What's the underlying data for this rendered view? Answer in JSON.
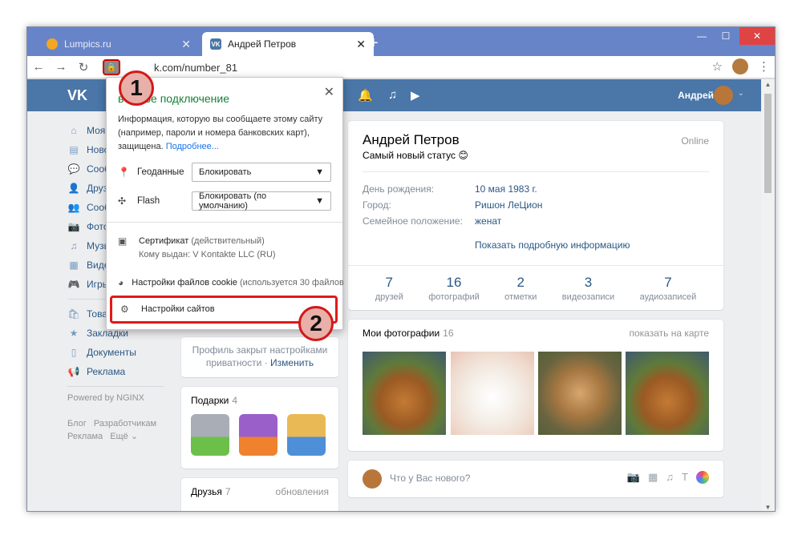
{
  "browser": {
    "tabs": [
      {
        "title": "Lumpics.ru",
        "active": false
      },
      {
        "title": "Андрей Петров",
        "active": true
      }
    ],
    "url": "vk.com/number_81",
    "url_visible": "k.com/number_81",
    "icons": [
      "back-icon",
      "forward-icon",
      "reload-icon",
      "lock-icon",
      "star-icon",
      "menu-icon"
    ]
  },
  "header": {
    "logo": "VK",
    "user_name": "Андрей"
  },
  "leftnav": {
    "items": [
      {
        "label": "Моя",
        "icon": "home-icon"
      },
      {
        "label": "Ново",
        "icon": "news-icon"
      },
      {
        "label": "Сооб",
        "icon": "messages-icon"
      },
      {
        "label": "Друз",
        "icon": "friends-icon"
      },
      {
        "label": "Сооб",
        "icon": "groups-icon"
      },
      {
        "label": "Фото",
        "icon": "photo-icon"
      },
      {
        "label": "Музы",
        "icon": "music-icon"
      },
      {
        "label": "Виде",
        "icon": "video-icon"
      },
      {
        "label": "Игры",
        "icon": "games-icon"
      }
    ],
    "items2": [
      {
        "label": "Това",
        "icon": "goods-icon"
      },
      {
        "label": "Закладки",
        "icon": "bookmarks-icon"
      },
      {
        "label": "Документы",
        "icon": "documents-icon"
      },
      {
        "label": "Реклама",
        "icon": "ads-icon"
      }
    ],
    "powered": "Powered by NGINX",
    "footer1": "Блог   Разработчикам",
    "footer2": "Реклама   Ещё ⌄"
  },
  "popup": {
    "title": "Безопасное подключение",
    "title_visible": "в   зное подключение",
    "description": "Информация, которую вы сообщаете этому сайту (например, пароли и номера банковских карт), защищена.",
    "more_link": "Подробнее...",
    "permissions": [
      {
        "label": "Геоданные",
        "value": "Блокировать",
        "icon": "location-icon"
      },
      {
        "label": "Flash",
        "value": "Блокировать (по умолчанию)",
        "icon": "puzzle-icon"
      }
    ],
    "certificate": {
      "label": "Сертификат",
      "state": "(действительный)",
      "issued": "Кому выдан: V Kontakte LLC (RU)"
    },
    "cookies": {
      "label": "Настройки файлов cookie",
      "note": "(используется 30 файлов"
    },
    "site_settings": "Настройки сайтов"
  },
  "profile": {
    "name": "Андрей Петров",
    "online": "Online",
    "status": "Самый новый статус 😊",
    "info": [
      {
        "key": "День рождения:",
        "value": "10 мая 1983 г."
      },
      {
        "key": "Город:",
        "value": "Ришон ЛеЦион"
      },
      {
        "key": "Семейное положение:",
        "value": "женат"
      }
    ],
    "more": "Показать подробную информацию",
    "counters": [
      {
        "n": "7",
        "label": "друзей"
      },
      {
        "n": "16",
        "label": "фотографий"
      },
      {
        "n": "2",
        "label": "отметки"
      },
      {
        "n": "3",
        "label": "видеозаписи"
      },
      {
        "n": "7",
        "label": "аудиозаписей"
      }
    ]
  },
  "photos": {
    "title": "Мои фотографии",
    "count": "16",
    "map_link": "показать на карте"
  },
  "post": {
    "placeholder": "Что у Вас нового?"
  },
  "privacy": {
    "text": "Профиль закрыт настройками приватности ·",
    "link": "Изменить"
  },
  "gifts": {
    "title": "Подарки",
    "count": "4"
  },
  "friends": {
    "title": "Друзья",
    "count": "7",
    "link": "обновления"
  },
  "callouts": [
    "1",
    "2"
  ],
  "colors": {
    "vk_blue": "#4a76a8",
    "link": "#2a5885",
    "secure_green": "#188038",
    "highlight_red": "#e01a1a"
  }
}
